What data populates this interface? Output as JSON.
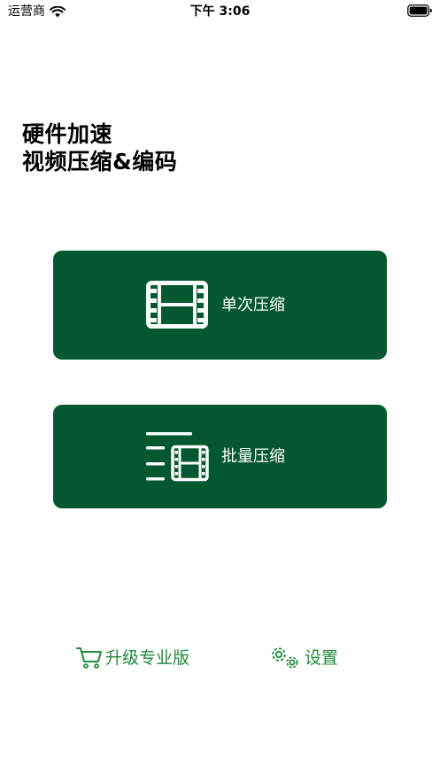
{
  "status_bar": {
    "carrier": "运营商",
    "time": "下午 3:06"
  },
  "headline": {
    "line1": "硬件加速",
    "line2": "视频压缩&编码"
  },
  "actions": {
    "single": {
      "label": "单次压缩",
      "icon": "film-icon"
    },
    "batch": {
      "label": "批量压缩",
      "icon": "batch-film-icon"
    }
  },
  "footer": {
    "upgrade": {
      "label": "升级专业版",
      "icon": "cart-icon"
    },
    "settings": {
      "label": "设置",
      "icon": "gears-icon"
    }
  },
  "colors": {
    "card_background": "#03582f",
    "link_green": "#1e8a3a",
    "text": "#000000"
  }
}
